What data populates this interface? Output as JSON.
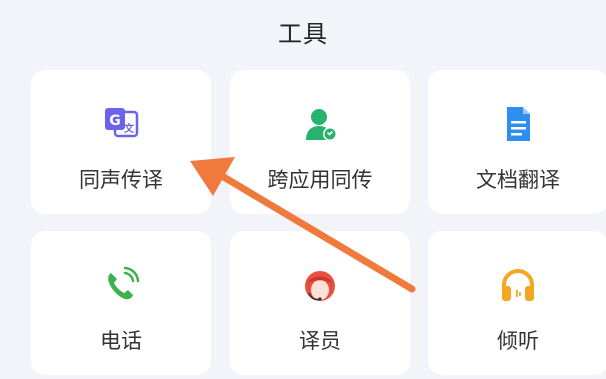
{
  "header": {
    "title": "工具"
  },
  "tools": [
    {
      "label": "同声传译",
      "icon": "translate-icon"
    },
    {
      "label": "跨应用同传",
      "icon": "cross-app-user-icon"
    },
    {
      "label": "文档翻译",
      "icon": "document-icon"
    },
    {
      "label": "电话",
      "icon": "phone-icon"
    },
    {
      "label": "译员",
      "icon": "interpreter-icon"
    },
    {
      "label": "倾听",
      "icon": "headphones-icon"
    }
  ],
  "colors": {
    "background": "#f3f4f9",
    "card": "#ffffff",
    "arrow": "#f07a3c",
    "translate_icon": "#6b63e9",
    "cross_app_icon": "#26b36d",
    "document_icon": "#2d8ff0",
    "phone_icon": "#3bb24c",
    "interpreter_icon": "#e9513f",
    "headphones_icon": "#f5a623"
  }
}
